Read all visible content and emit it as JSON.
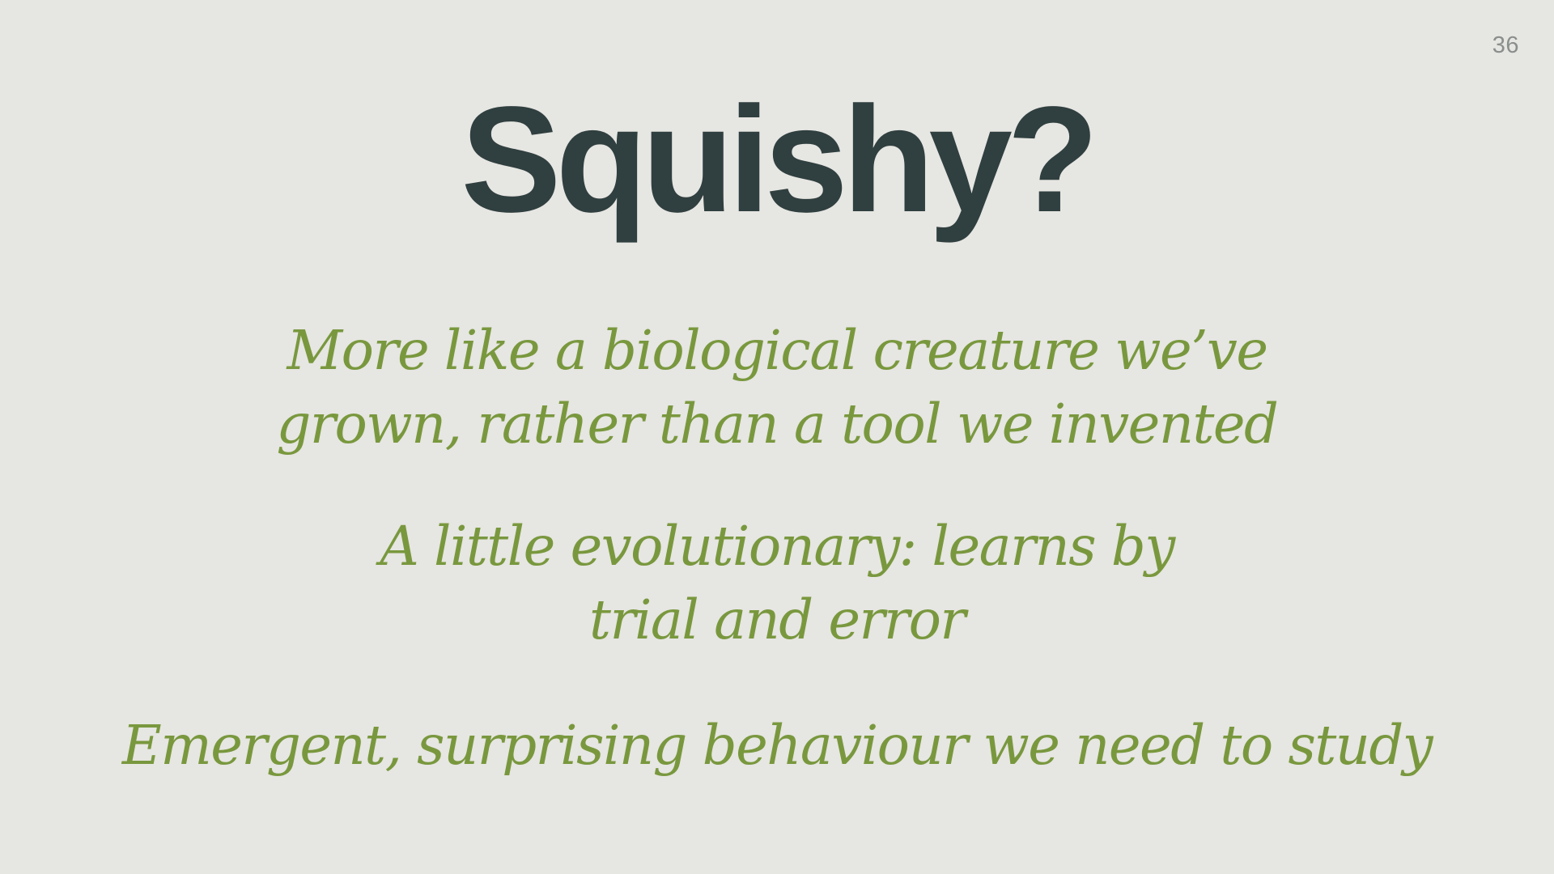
{
  "slide": {
    "page_number": "36",
    "title": "Squishy?",
    "points": [
      {
        "lines": [
          "More like a biological creature we’ve",
          "grown, rather than a tool we invented"
        ]
      },
      {
        "lines": [
          "A little evolutionary: learns by",
          "trial and error"
        ]
      },
      {
        "lines": [
          "Emergent, surprising behaviour we need to study"
        ]
      }
    ]
  },
  "colors": {
    "background": "#e6e6e2",
    "title": "#303f3f",
    "accent": "#79983e",
    "page_number": "#8a8f8d"
  }
}
